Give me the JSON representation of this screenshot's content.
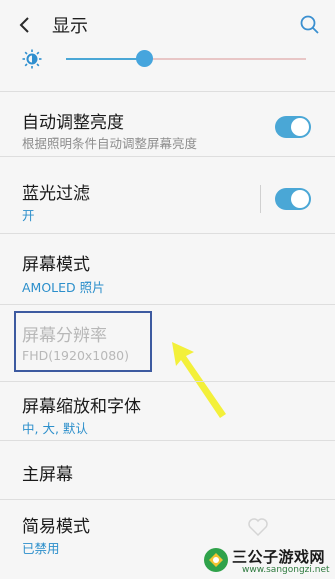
{
  "header": {
    "title": "显示",
    "back_icon": "chevron-left-icon",
    "search_icon": "search-icon"
  },
  "brightness": {
    "icon": "brightness-sun-icon",
    "level_fraction": 0.3,
    "accent": "#46a5dd"
  },
  "items": [
    {
      "title": "自动调整亮度",
      "subtitle": "根据照明条件自动调整屏幕亮度",
      "toggle": true
    },
    {
      "title": "蓝光过滤",
      "subtitle": "开",
      "toggle": true
    },
    {
      "title": "屏幕模式",
      "subtitle": "AMOLED 照片"
    },
    {
      "title": "屏幕分辨率",
      "subtitle": "FHD(1920x1080)",
      "disabled": true
    },
    {
      "title": "屏幕缩放和字体",
      "subtitle": "中, 大, 默认"
    },
    {
      "title": "主屏幕"
    },
    {
      "title": "简易模式",
      "subtitle": "已禁用"
    }
  ],
  "watermark": {
    "name": "三公子游戏网",
    "url": "www.sangongzi.net"
  },
  "colors": {
    "accent": "#4aa7d6",
    "link_subtitle": "#2c8fcb",
    "highlight_box": "#3d5aa0",
    "annotation_arrow": "#f3f03a"
  }
}
